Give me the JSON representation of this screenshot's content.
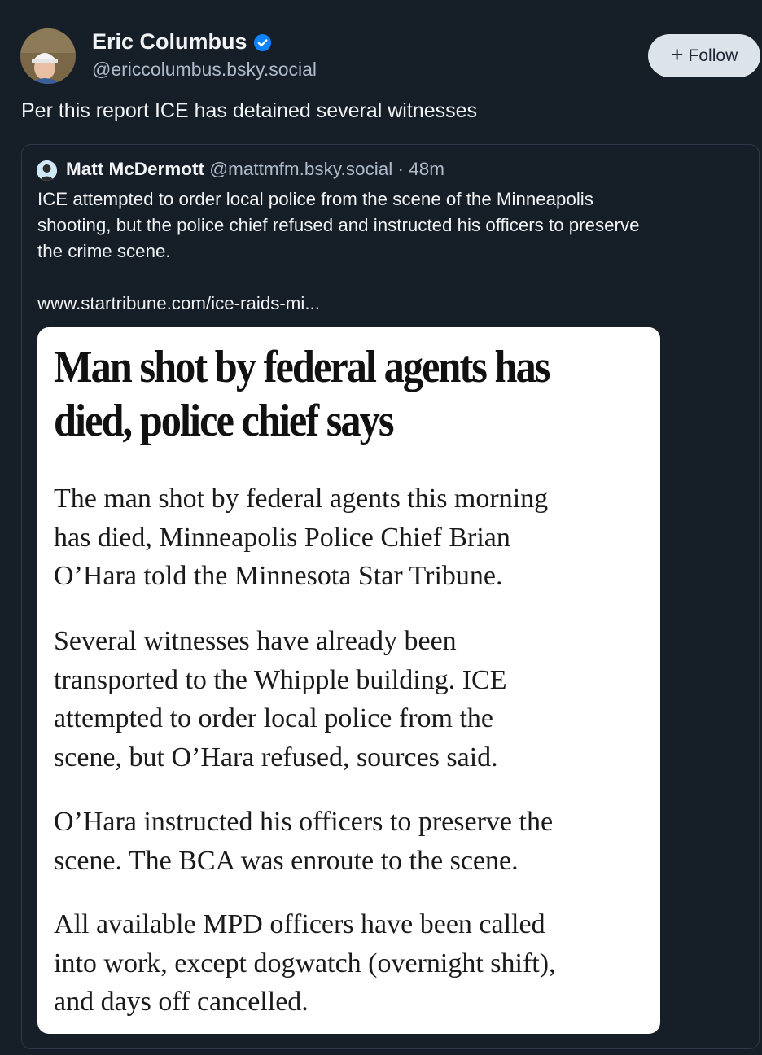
{
  "post": {
    "author_name": "Eric Columbus",
    "author_handle": "@ericcolumbus.bsky.social",
    "follow_label": "Follow",
    "text": "Per this report ICE has detained several witnesses"
  },
  "quote": {
    "author_name": "Matt McDermott",
    "author_handle": "@mattmfm.bsky.social",
    "separator": "·",
    "time": "48m",
    "text": "ICE attempted to order local police from the scene of the Minneapolis\nshooting, but the police chief refused and instructed his officers to preserve\nthe crime scene.",
    "link": "www.startribune.com/ice-raids-mi..."
  },
  "article": {
    "headline": "Man shot by federal agents has\ndied, police chief says",
    "paragraphs": [
      "The man shot by federal agents this morning\nhas died, Minneapolis Police Chief Brian\nO’Hara told the Minnesota Star Tribune.",
      "Several witnesses have already been\ntransported to the Whipple building. ICE\nattempted to order local police from the\nscene, but O’Hara refused, sources said.",
      "O’Hara instructed his officers to preserve the\nscene. The BCA was enroute to the scene.",
      "All available MPD officers have been called\ninto work, except dogwatch (overnight shift),\nand days off cancelled."
    ]
  },
  "colors": {
    "background": "#161e27",
    "verified": "#1083fe",
    "follow_button": "#dde3ea",
    "secondary_text": "#aebbc9"
  }
}
